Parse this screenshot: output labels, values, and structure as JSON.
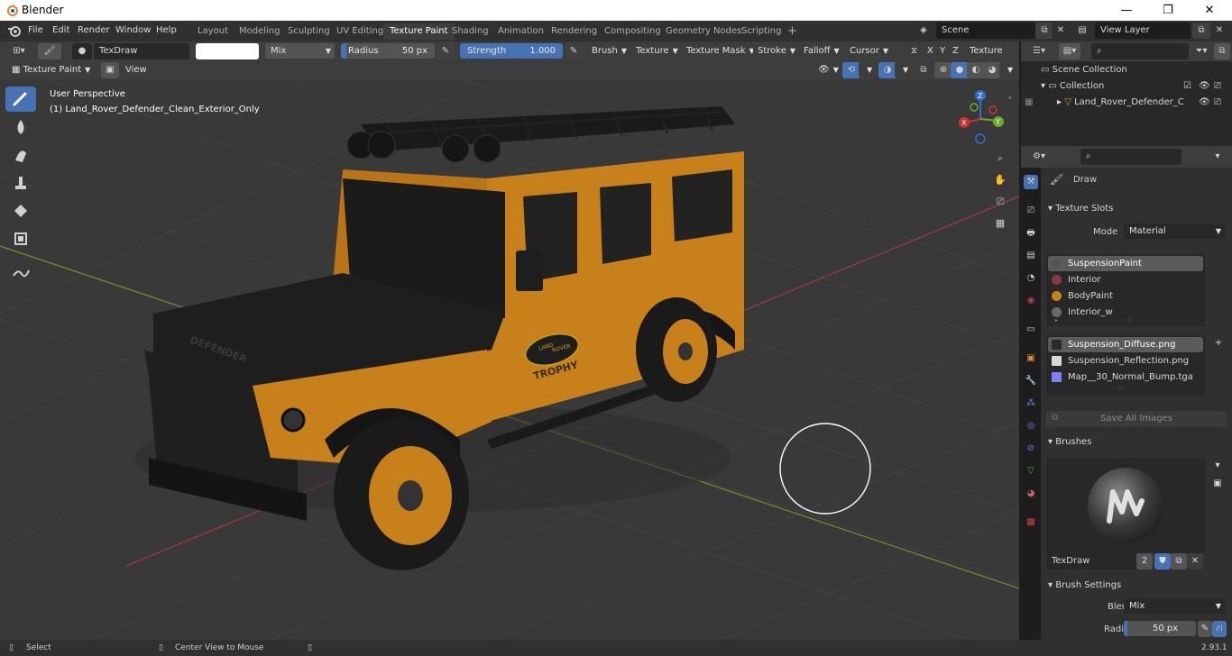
{
  "window": {
    "title": "Blender",
    "minimize": "—",
    "maximize": "❐",
    "close": "✕"
  },
  "menu": {
    "items": [
      "File",
      "Edit",
      "Render",
      "Window",
      "Help"
    ]
  },
  "workspaces": {
    "tabs": [
      "Layout",
      "Modeling",
      "Sculpting",
      "UV Editing",
      "Texture Paint",
      "Shading",
      "Animation",
      "Rendering",
      "Compositing",
      "Geometry Nodes",
      "Scripting"
    ],
    "active": "Texture Paint",
    "add": "+"
  },
  "scene": {
    "label": "Scene",
    "view_layer": "View Layer"
  },
  "tool_header": {
    "brush_name": "TexDraw",
    "blend": "Mix",
    "radius_label": "Radius",
    "radius_value": "50 px",
    "strength_label": "Strength",
    "strength_value": "1.000",
    "strength_fraction": 1.0,
    "menus": [
      "Brush",
      "Texture",
      "Texture Mask",
      "Stroke",
      "Falloff",
      "Cursor"
    ],
    "texture_slots": "Texture Slots"
  },
  "header2": {
    "mode": "Texture Paint",
    "view": "View"
  },
  "viewport": {
    "perspective": "User Perspective",
    "object_label": "(1) Land_Rover_Defender_Clean_Exterior_Only",
    "gizmo": {
      "x": "X",
      "y": "Y",
      "z": "Z"
    },
    "vehicle": {
      "hood_text": "DEFENDER",
      "badge_line1": "LAND",
      "badge_line2": "ROVER",
      "badge_line3": "TROPHY"
    },
    "colors": {
      "body": "#c8811a",
      "black": "#1e1e1e",
      "floor": "#393939",
      "red_axis": "#9b3a3a",
      "green_axis": "#6b8f2a"
    }
  },
  "axes": {
    "x": "X",
    "y": "Y",
    "z": "Z"
  },
  "outliner": {
    "root": "Scene Collection",
    "collection": "Collection",
    "object": "Land_Rover_Defender_C"
  },
  "properties": {
    "tool_name": "Draw",
    "texture_slots_title": "Texture Slots",
    "mode_label": "Mode",
    "mode_value": "Material",
    "materials": [
      {
        "name": "SuspensionPaint",
        "selected": true,
        "color": "#555555"
      },
      {
        "name": "Interior",
        "selected": false,
        "color": "#8a3a3a"
      },
      {
        "name": "BodyPaint",
        "selected": false,
        "color": "#c8811a"
      },
      {
        "name": "Interior_w",
        "selected": false,
        "color": "#6a6a6a"
      }
    ],
    "images": [
      {
        "name": "Suspension_Diffuse.png",
        "selected": true,
        "color": "#2a2a2a"
      },
      {
        "name": "Suspension_Reflection.png",
        "selected": false,
        "color": "#d8d8d8"
      },
      {
        "name": "Map__30_Normal_Bump.tga",
        "selected": false,
        "color": "#8080ff"
      }
    ],
    "save_all": "Save All Images",
    "brushes_title": "Brushes",
    "brush_name": "TexDraw",
    "brush_users": "2",
    "brush_settings_title": "Brush Settings",
    "blend_label": "Blend",
    "blend_value": "Mix",
    "radius_label": "Radius",
    "radius_value": "50 px"
  },
  "status": {
    "select": "Select",
    "center": "Center View to Mouse",
    "version": "2.93.1"
  }
}
